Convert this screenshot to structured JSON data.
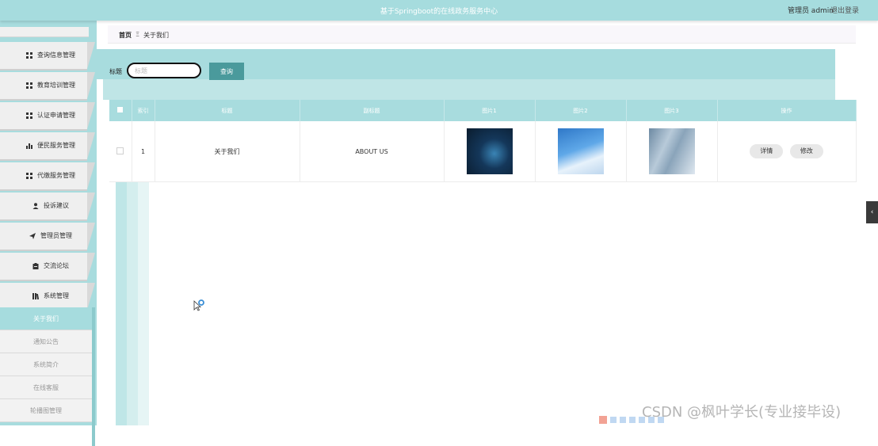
{
  "header": {
    "title": "基于Springboot的在线政务服务中心",
    "user": "管理员 admin",
    "logout": "退出登录"
  },
  "sidebar": {
    "items": [
      {
        "label": "查询信息管理",
        "icon": "grid-icon"
      },
      {
        "label": "教育培训管理",
        "icon": "grid-icon"
      },
      {
        "label": "认证申请管理",
        "icon": "grid-icon"
      },
      {
        "label": "便民服务管理",
        "icon": "bar-chart-icon"
      },
      {
        "label": "代缴服务管理",
        "icon": "grid-icon"
      },
      {
        "label": "投诉建议",
        "icon": "user-icon"
      },
      {
        "label": "管理员管理",
        "icon": "send-icon"
      },
      {
        "label": "交流论坛",
        "icon": "clipboard-icon"
      },
      {
        "label": "系统管理",
        "icon": "book-icon"
      }
    ],
    "sub_items": [
      {
        "label": "关于我们",
        "active": true
      },
      {
        "label": "通知公告",
        "active": false
      },
      {
        "label": "系统简介",
        "active": false
      },
      {
        "label": "在线客服",
        "active": false
      },
      {
        "label": "轮播图管理",
        "active": false
      }
    ]
  },
  "breadcrumb": {
    "home": "首页",
    "separator": "Ξ",
    "current": "关于我们"
  },
  "search": {
    "label": "标题",
    "placeholder": "标题",
    "button": "查询"
  },
  "table": {
    "headers": [
      "",
      "索引",
      "标题",
      "副标题",
      "图片1",
      "图片2",
      "图片3",
      "操作"
    ],
    "rows": [
      {
        "index": "1",
        "title": "关于我们",
        "subtitle": "ABOUT US",
        "images": [
          "tech-hand-image",
          "blue-sky-image",
          "building-glass-image"
        ],
        "actions": [
          "详情",
          "修改"
        ]
      }
    ]
  },
  "watermark": "CSDN @枫叶学长(专业接毕设)",
  "colors": {
    "accent": "#a6dcde",
    "button": "#4a9a9c"
  }
}
